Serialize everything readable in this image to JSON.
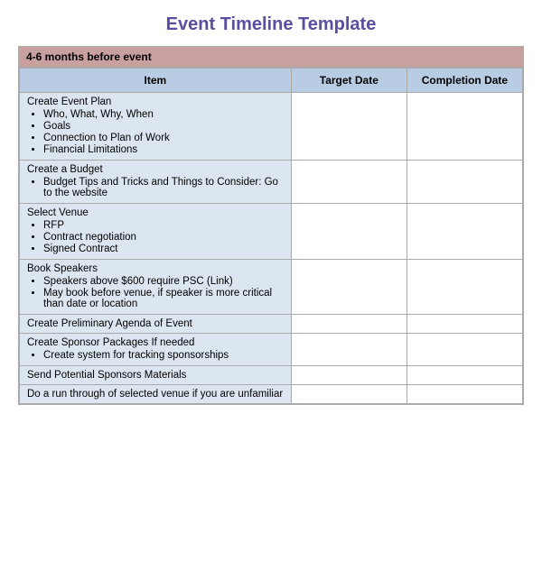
{
  "title": "Event Timeline Template",
  "section_header": "4-6 months before event",
  "columns": [
    "Item",
    "Target Date",
    "Completion Date"
  ],
  "rows": [
    {
      "item": "Create Event Plan",
      "subitems": [
        "Who, What, Why, When",
        "Goals",
        "Connection to Plan of Work",
        "Financial Limitations"
      ],
      "target_date": "",
      "completion_date": ""
    },
    {
      "item": "Create a Budget",
      "subitems": [
        "Budget Tips and Tricks and Things to Consider: Go to the website"
      ],
      "target_date": "",
      "completion_date": ""
    },
    {
      "item": "Select Venue",
      "subitems": [
        "RFP",
        "Contract negotiation",
        "Signed Contract"
      ],
      "target_date": "",
      "completion_date": ""
    },
    {
      "item": "Book Speakers",
      "subitems": [
        "Speakers above $600 require PSC (Link)",
        "May book before venue, if speaker is more critical than date or location"
      ],
      "target_date": "",
      "completion_date": ""
    },
    {
      "item": "Create Preliminary Agenda of Event",
      "subitems": [],
      "target_date": "",
      "completion_date": ""
    },
    {
      "item": "Create Sponsor Packages If needed",
      "subitems": [
        "Create system for tracking sponsorships"
      ],
      "target_date": "",
      "completion_date": ""
    },
    {
      "item": "Send Potential Sponsors Materials",
      "subitems": [],
      "target_date": "",
      "completion_date": ""
    },
    {
      "item": "Do a run through of selected venue if you are unfamiliar",
      "subitems": [],
      "target_date": "",
      "completion_date": ""
    }
  ]
}
